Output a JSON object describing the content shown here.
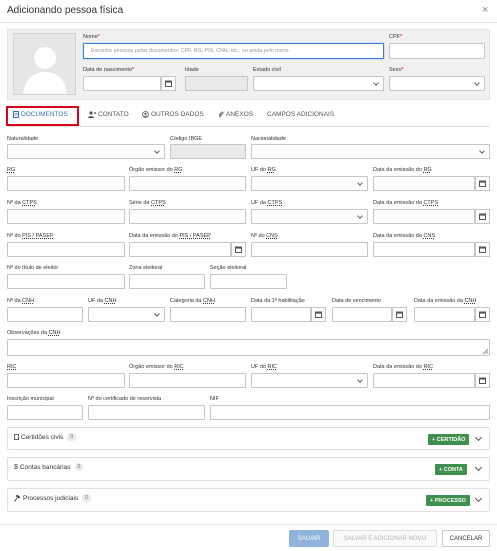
{
  "dialog": {
    "title": "Adicionando pessoa física",
    "close": "×"
  },
  "header": {
    "nome_label": "Nome",
    "nome_placeholder": "Encontre pessoas pelos documentos: CPF, RG, PIS, CNH, etc., ou ainda pelo nome.",
    "cpf_label": "CPF",
    "nascimento_label": "Data de nascimento",
    "idade_label": "Idade",
    "estado_civil_label": "Estado civil",
    "sexo_label": "Sexo",
    "required_mark": "*"
  },
  "tabs": [
    {
      "label": "DOCUMENTOS",
      "icon": "document-icon"
    },
    {
      "label": "CONTATO",
      "icon": "contact-icon"
    },
    {
      "label": "OUTROS DADOS",
      "icon": "user-circle-icon"
    },
    {
      "label": "ANEXOS",
      "icon": "paperclip-icon"
    },
    {
      "label": "CAMPOS ADICIONAIS",
      "icon": ""
    }
  ],
  "fields": {
    "naturalidade": "Naturalidade",
    "codigo_ibge": "Código IBGE",
    "nacionalidade": "Nacionalidade",
    "rg_prefix": "",
    "rg_abbr": "RG",
    "orgao_rg_prefix": "Órgão emissor do ",
    "orgao_rg_abbr": "RG",
    "uf_rg_prefix": "UF do ",
    "uf_rg_abbr": "RG",
    "data_rg_prefix": "Data da emissão do ",
    "data_rg_abbr": "RG",
    "ctps_prefix": "Nº da ",
    "ctps_abbr": "CTPS",
    "serie_ctps_prefix": "Série da ",
    "serie_ctps_abbr": "CTPS",
    "uf_ctps_prefix": "UF da ",
    "uf_ctps_abbr": "CTPS",
    "data_ctps_prefix": "Data da emissão da ",
    "data_ctps_abbr": "CTPS",
    "pis_prefix": "Nº do ",
    "pis_abbr": "PIS / PASEP",
    "data_pis_prefix": "Data da emissão do ",
    "data_pis_abbr": "PIS / PASEP",
    "cns_prefix": "Nº do ",
    "cns_abbr": "CNS",
    "data_cns_prefix": "Data da emissão do ",
    "data_cns_abbr": "CNS",
    "titulo_eleitor": "Nº do título de eleitor",
    "zona_eleitoral": "Zona eleitoral",
    "secao_eleitoral": "Seção eleitoral",
    "cnh_prefix": "Nº da ",
    "cnh_abbr": "CNH",
    "uf_cnh_prefix": "UF da ",
    "uf_cnh_abbr": "CNH",
    "cat_cnh_prefix": "Categoria da ",
    "cat_cnh_abbr": "CNH",
    "primeira_hab": "Data da 1ª habilitação",
    "vencimento": "Data de vencimento",
    "data_cnh_prefix": "Data da emissão da ",
    "data_cnh_abbr": "CNH",
    "obs_cnh_prefix": "Observações da ",
    "obs_cnh_abbr": "CNH",
    "ric_prefix": "",
    "ric_abbr": "RIC",
    "orgao_ric_prefix": "Órgão emissor do ",
    "orgao_ric_abbr": "RIC",
    "uf_ric_prefix": "UF do ",
    "uf_ric_abbr": "RIC",
    "data_ric_prefix": "Data da emissão do ",
    "data_ric_abbr": "RIC",
    "inscricao_municipal": "Inscrição municipal",
    "reservista": "Nº do certificado de reservista",
    "nif": "NIF"
  },
  "panels": [
    {
      "title": "Certidões civis",
      "count": "0",
      "button": "+ CERTIDÃO",
      "icon": "document-icon"
    },
    {
      "title": "Contas bancárias",
      "count": "0",
      "button": "+ CONTA",
      "icon": "dollar-icon"
    },
    {
      "title": "Processos judiciais",
      "count": "0",
      "button": "+ PROCESSO",
      "icon": "gavel-icon"
    }
  ],
  "footer": {
    "save": "SALVAR",
    "save_new": "SALVAR E ADICIONAR NOVO",
    "cancel": "CANCELAR"
  },
  "colors": {
    "accent": "#3a6fb0",
    "highlight": "#d9001b",
    "success": "#3f8f4f"
  }
}
